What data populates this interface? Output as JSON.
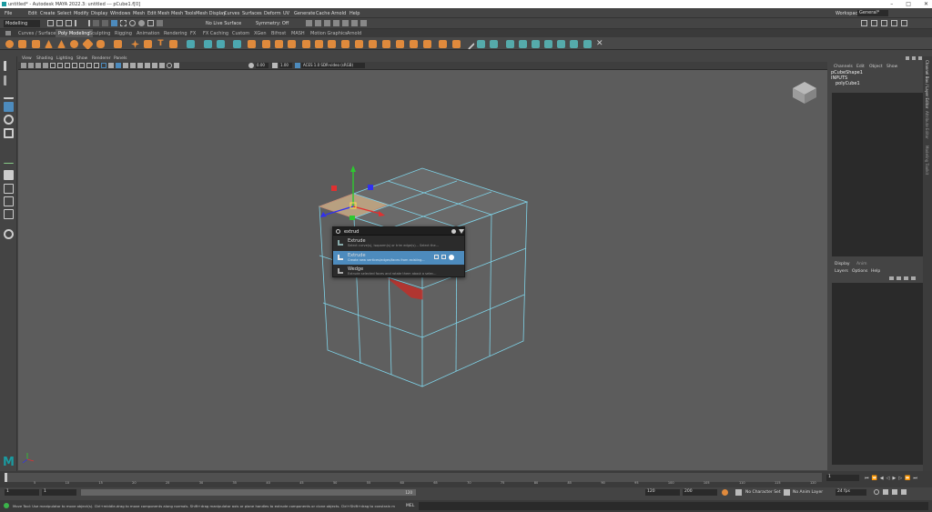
{
  "window": {
    "title": "untitled* - Autodesk MAYA 2022.3: untitled --- pCube1.f[0]",
    "controls": [
      "–",
      "□",
      "✕"
    ]
  },
  "menubar": {
    "items": [
      "File",
      "Edit",
      "Create",
      "Select",
      "Modify",
      "Display",
      "Windows",
      "Mesh",
      "Edit Mesh",
      "Mesh Tools",
      "Mesh Display",
      "Curves",
      "Surfaces",
      "Deform",
      "UV",
      "Generate",
      "Cache",
      "Arnold",
      "Help"
    ],
    "workspace_label": "Workspace:",
    "workspace_value": "General*"
  },
  "toolbar": {
    "mode": "Modelling",
    "live_surface": "No Live Surface",
    "symmetry": "Symmetry: Off"
  },
  "shelf": {
    "tabs": [
      "Curves / Surfaces",
      "Poly Modeling",
      "Sculpting",
      "Rigging",
      "Animation",
      "Rendering",
      "FX",
      "FX Caching",
      "Custom",
      "XGen",
      "Bifrost",
      "MASH",
      "Motion Graphics",
      "Arnold"
    ],
    "active_tab": "Poly Modeling"
  },
  "viewport": {
    "menu": [
      "View",
      "Shading",
      "Lighting",
      "Show",
      "Renderer",
      "Panels"
    ],
    "exposure": "0.00",
    "gamma": "1.00",
    "colorspace": "ACES 1.0 SDR-video (sRGB)"
  },
  "search_popup": {
    "query": "extrud",
    "results": [
      {
        "title": "Extrude",
        "desc": "Select curve(s), isoparm(s) or trim edge(s)... Select the..."
      },
      {
        "title": "Extrude",
        "desc": "Create new vertices/edges/faces from existing..."
      },
      {
        "title": "Wedge",
        "desc": "Extrude selected faces and rotate them about a selec..."
      }
    ]
  },
  "channel_box": {
    "menu": [
      "Channels",
      "Edit",
      "Object",
      "Show"
    ],
    "object": "pCubeShape1",
    "inputs_label": "INPUTS",
    "input_node": "polyCube1"
  },
  "layer_editor": {
    "tabs": [
      "Display",
      "Anim"
    ],
    "menu": [
      "Layers",
      "Options",
      "Help"
    ]
  },
  "side_tabs": [
    "Channel Box / Layer Editor",
    "Attribute Editor",
    "Modeling Toolkit"
  ],
  "timeline": {
    "ticks": [
      "5",
      "10",
      "15",
      "20",
      "25",
      "30",
      "35",
      "40",
      "45",
      "50",
      "55",
      "60",
      "65",
      "70",
      "75",
      "80",
      "85",
      "90",
      "95",
      "100",
      "105",
      "110",
      "115",
      "120"
    ],
    "current_frame": "1",
    "start": "1",
    "range_start": "1",
    "range_end": "120",
    "end_a": "120",
    "end_b": "200",
    "character_set": "No Character Set",
    "anim_layer": "No Anim Layer",
    "fps": "24 fps"
  },
  "status": {
    "help": "Move Tool: Use manipulator to move object(s). Ctrl+middle-drag to move components along normals. Shift+drag manipulator axis or plane handles to extrude components or clone objects. Ctrl+Shift+drag to constrain movement to a co...",
    "mel": "MEL"
  },
  "colors": {
    "accent_blue": "#4d8bbd",
    "shelf_orange": "#e08a3c",
    "wire_cyan": "#7fd3e8",
    "face_red": "#c0302a"
  }
}
